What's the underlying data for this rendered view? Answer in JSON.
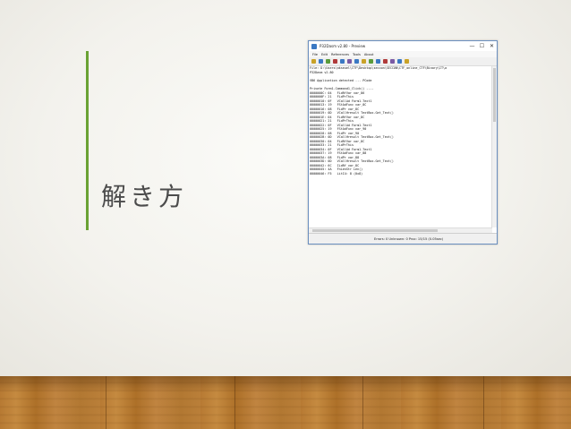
{
  "slide": {
    "title": "解き方"
  },
  "window": {
    "title": "P32Dasm v2.80 - Preview",
    "controls": {
      "minimize": "—",
      "maximize": "☐",
      "close": "✕"
    },
    "menu": [
      "File",
      "Edit",
      "References",
      "Tools",
      "About"
    ],
    "toolbar_colors": [
      "#c9a227",
      "#3a78c3",
      "#5a9b3a",
      "#b03a3a",
      "#3a78c3",
      "#7a5aa5",
      "#3a78c3",
      "#c9a227",
      "#5a9b3a",
      "#3a78c3",
      "#b03a3a",
      "#7a5aa5",
      "#3a78c3",
      "#c9a227"
    ],
    "path": "File: D:\\Users\\akseuel\\CTF\\Desktop\\seccon\\SECCON\\CTF_online_CTF\\Binary\\IT\\a",
    "lines": [
      "P32Dasm v2.80",
      "",
      "VB6 Application detected ... PCode",
      "",
      "Private Form1.Command1_Click() ----",
      "0000000C: 04   FLdRfVar var_86",
      "0000000F: 21   FLdPrThis",
      "00000010: 0F   VCallAd Form1.Text1",
      "00000013: 19   FStAdFunc var_8C",
      "00000016: 08   FLdPr var_8C",
      "00000019: 0D   VCallHresult TextBox.Get_Text()",
      "0000001E: 04   FLdRfVar var_8C",
      "00000021: 21   FLdPrThis",
      "00000022: 0F   VCallAd Form1.Text1",
      "00000025: 19   FStAdFunc var_90",
      "00000028: 08   FLdPr var_90",
      "0000002B: 0D   VCallHresult TextBox.Get_Text()",
      "00000030: 04   FLdRfVar var_8C",
      "00000033: 21   FLdPrThis",
      "00000034: 0F   VCallAd Form1.Text1",
      "00000037: 19   FStAdFunc var_88",
      "0000003A: 08   FLdPr var_88",
      "0000003D: 0D   VCallHresult TextBox.Get_Text()",
      "00000042: 6C   ILdRf var_8C",
      "00000045: 4A   FnLenStr Len()",
      "00000046: F5   LitI4: 8 (0x8)"
    ],
    "status": {
      "left": "",
      "right": "Errors: 0  Unknown: 0  Proc: 15/15  (0.05sec)"
    }
  }
}
